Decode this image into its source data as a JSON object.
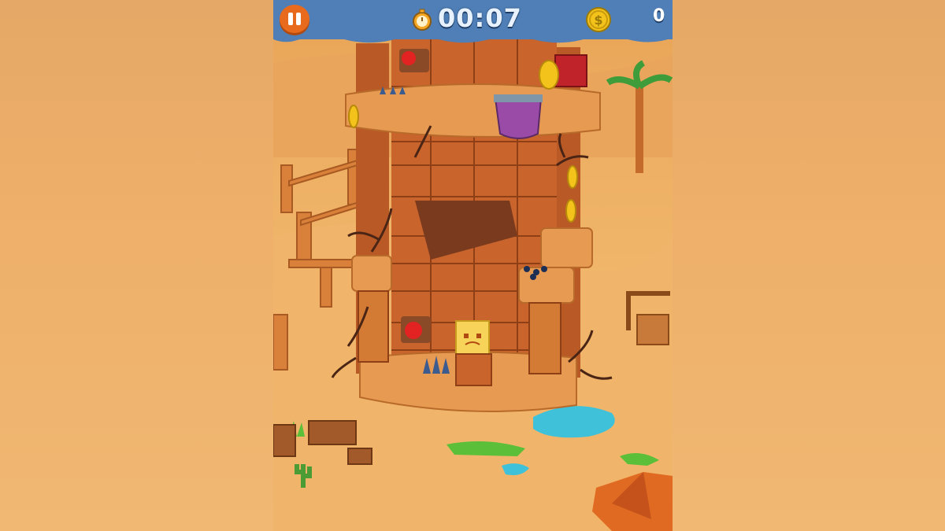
{
  "hud": {
    "pause_icon": "pause-icon",
    "timer_icon": "stopwatch-icon",
    "timer": "00:07",
    "coin_icon": "dollar-coin-icon",
    "coins": "0"
  },
  "colors": {
    "hud_bg": "#4f7fb6",
    "pause_button": "#e86a1c",
    "coin": "#f3c21b",
    "sand": "#eeb165",
    "brick": "#c8642c"
  }
}
